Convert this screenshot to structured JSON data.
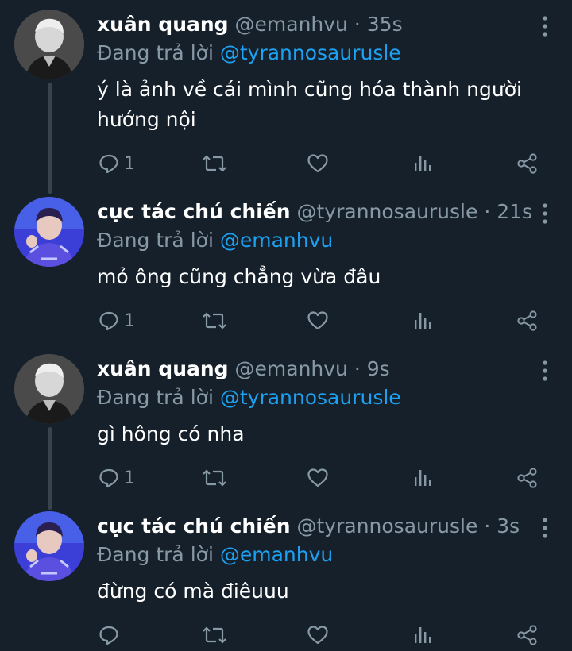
{
  "colors": {
    "background": "#15202b",
    "secondary_text": "#8899a6",
    "mention": "#1da1f2",
    "thread_line": "#38444d"
  },
  "tweets": [
    {
      "name": "xuân quang",
      "handle": "@emanhvu",
      "separator": "·",
      "time": "35s",
      "reply_prefix": "Đang trả lời",
      "reply_to": "@tyrannosaurusle",
      "text": "ý là ảnh về cái mình cũng hóa thành người hướng nội",
      "reply_count": "1",
      "avatar": "avatar-bw"
    },
    {
      "name": "cục tác chú chiến",
      "handle": "@tyrannosaurusle",
      "separator": "·",
      "time": "21s",
      "reply_prefix": "Đang trả lời",
      "reply_to": "@emanhvu",
      "text": "mỏ ông cũng chẳng vừa đâu",
      "reply_count": "1",
      "avatar": "avatar-blue"
    },
    {
      "name": "xuân quang",
      "handle": "@emanhvu",
      "separator": "·",
      "time": "9s",
      "reply_prefix": "Đang trả lời",
      "reply_to": "@tyrannosaurusle",
      "text": "gì hông có nha",
      "reply_count": "1",
      "avatar": "avatar-bw"
    },
    {
      "name": "cục tác chú chiến",
      "handle": "@tyrannosaurusle",
      "separator": "·",
      "time": "3s",
      "reply_prefix": "Đang trả lời",
      "reply_to": "@emanhvu",
      "text": "đừng có mà điêuuu",
      "reply_count": "",
      "avatar": "avatar-blue"
    }
  ],
  "icons": {
    "reply": "reply-icon",
    "retweet": "retweet-icon",
    "like": "heart-icon",
    "analytics": "analytics-icon",
    "share": "share-icon",
    "more": "more-vertical-icon"
  }
}
